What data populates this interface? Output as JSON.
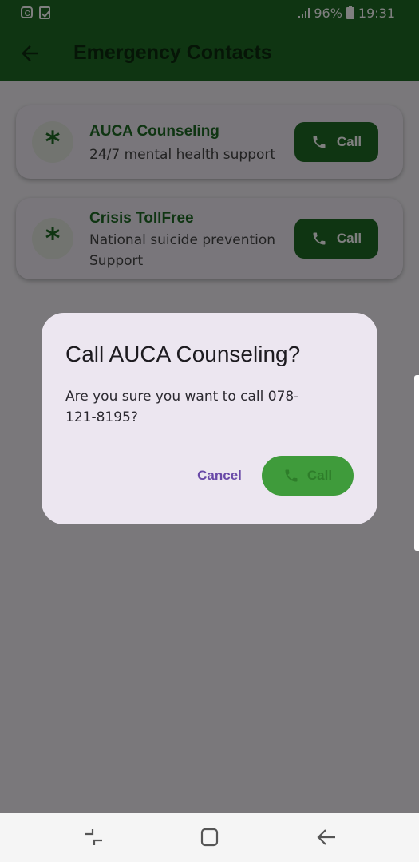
{
  "status_bar": {
    "battery": "96%",
    "time": "19:31"
  },
  "app_bar": {
    "title": "Emergency Contacts"
  },
  "contacts": [
    {
      "icon": "*",
      "name": "AUCA Counseling",
      "description": "24/7 mental health support",
      "call_label": "Call"
    },
    {
      "icon": "*",
      "name": "Crisis TollFree",
      "description": "National suicide prevention Support",
      "call_label": "Call"
    }
  ],
  "dialog": {
    "title": "Call AUCA Counseling?",
    "message": "Are you sure you want to call 078-121-8195?",
    "cancel_label": "Cancel",
    "confirm_label": "Call"
  },
  "colors": {
    "primary": "#1e6a24",
    "accent": "#6a4aa8",
    "dialog_button": "#3f9b3b"
  },
  "icons": [
    "instagram-icon",
    "checklist-icon",
    "signal-icon",
    "battery-icon",
    "back-arrow-icon",
    "phone-icon",
    "recents-icon",
    "home-icon",
    "nav-back-icon"
  ]
}
